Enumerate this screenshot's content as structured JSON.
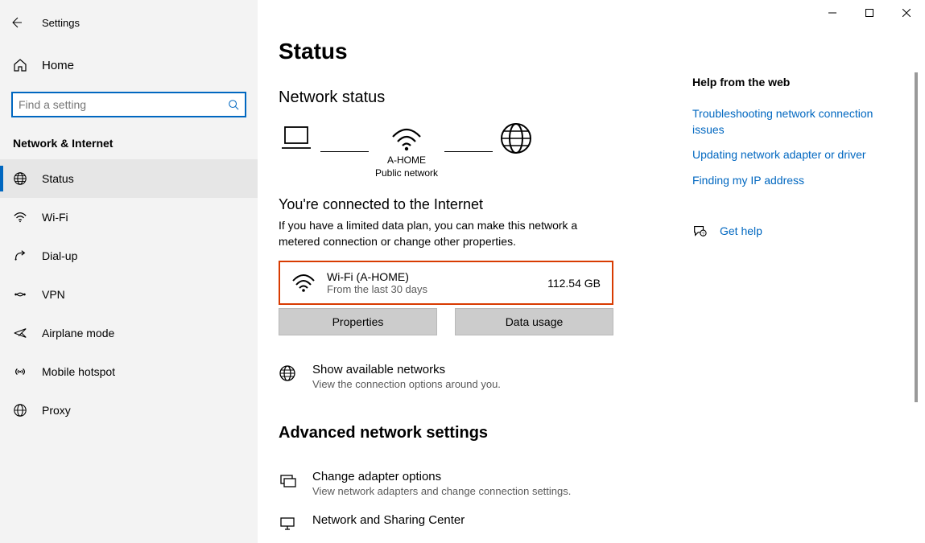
{
  "window": {
    "title": "Settings"
  },
  "sidebar": {
    "home": "Home",
    "search_placeholder": "Find a setting",
    "section": "Network & Internet",
    "items": [
      {
        "label": "Status"
      },
      {
        "label": "Wi-Fi"
      },
      {
        "label": "Dial-up"
      },
      {
        "label": "VPN"
      },
      {
        "label": "Airplane mode"
      },
      {
        "label": "Mobile hotspot"
      },
      {
        "label": "Proxy"
      }
    ]
  },
  "page": {
    "title": "Status",
    "network_status": "Network status",
    "diagram_ssid": "A-HOME",
    "diagram_type": "Public network",
    "connected_heading": "You're connected to the Internet",
    "connected_body": "If you have a limited data plan, you can make this network a metered connection or change other properties.",
    "card": {
      "title": "Wi-Fi (A-HOME)",
      "sub": "From the last 30 days",
      "usage": "112.54 GB"
    },
    "properties_btn": "Properties",
    "data_usage_btn": "Data usage",
    "show_networks_title": "Show available networks",
    "show_networks_sub": "View the connection options around you.",
    "advanced_heading": "Advanced network settings",
    "adapter_title": "Change adapter options",
    "adapter_sub": "View network adapters and change connection settings.",
    "sharing_title": "Network and Sharing Center"
  },
  "aside": {
    "heading": "Help from the web",
    "links": [
      "Troubleshooting network connection issues",
      "Updating network adapter or driver",
      "Finding my IP address"
    ],
    "get_help": "Get help"
  }
}
